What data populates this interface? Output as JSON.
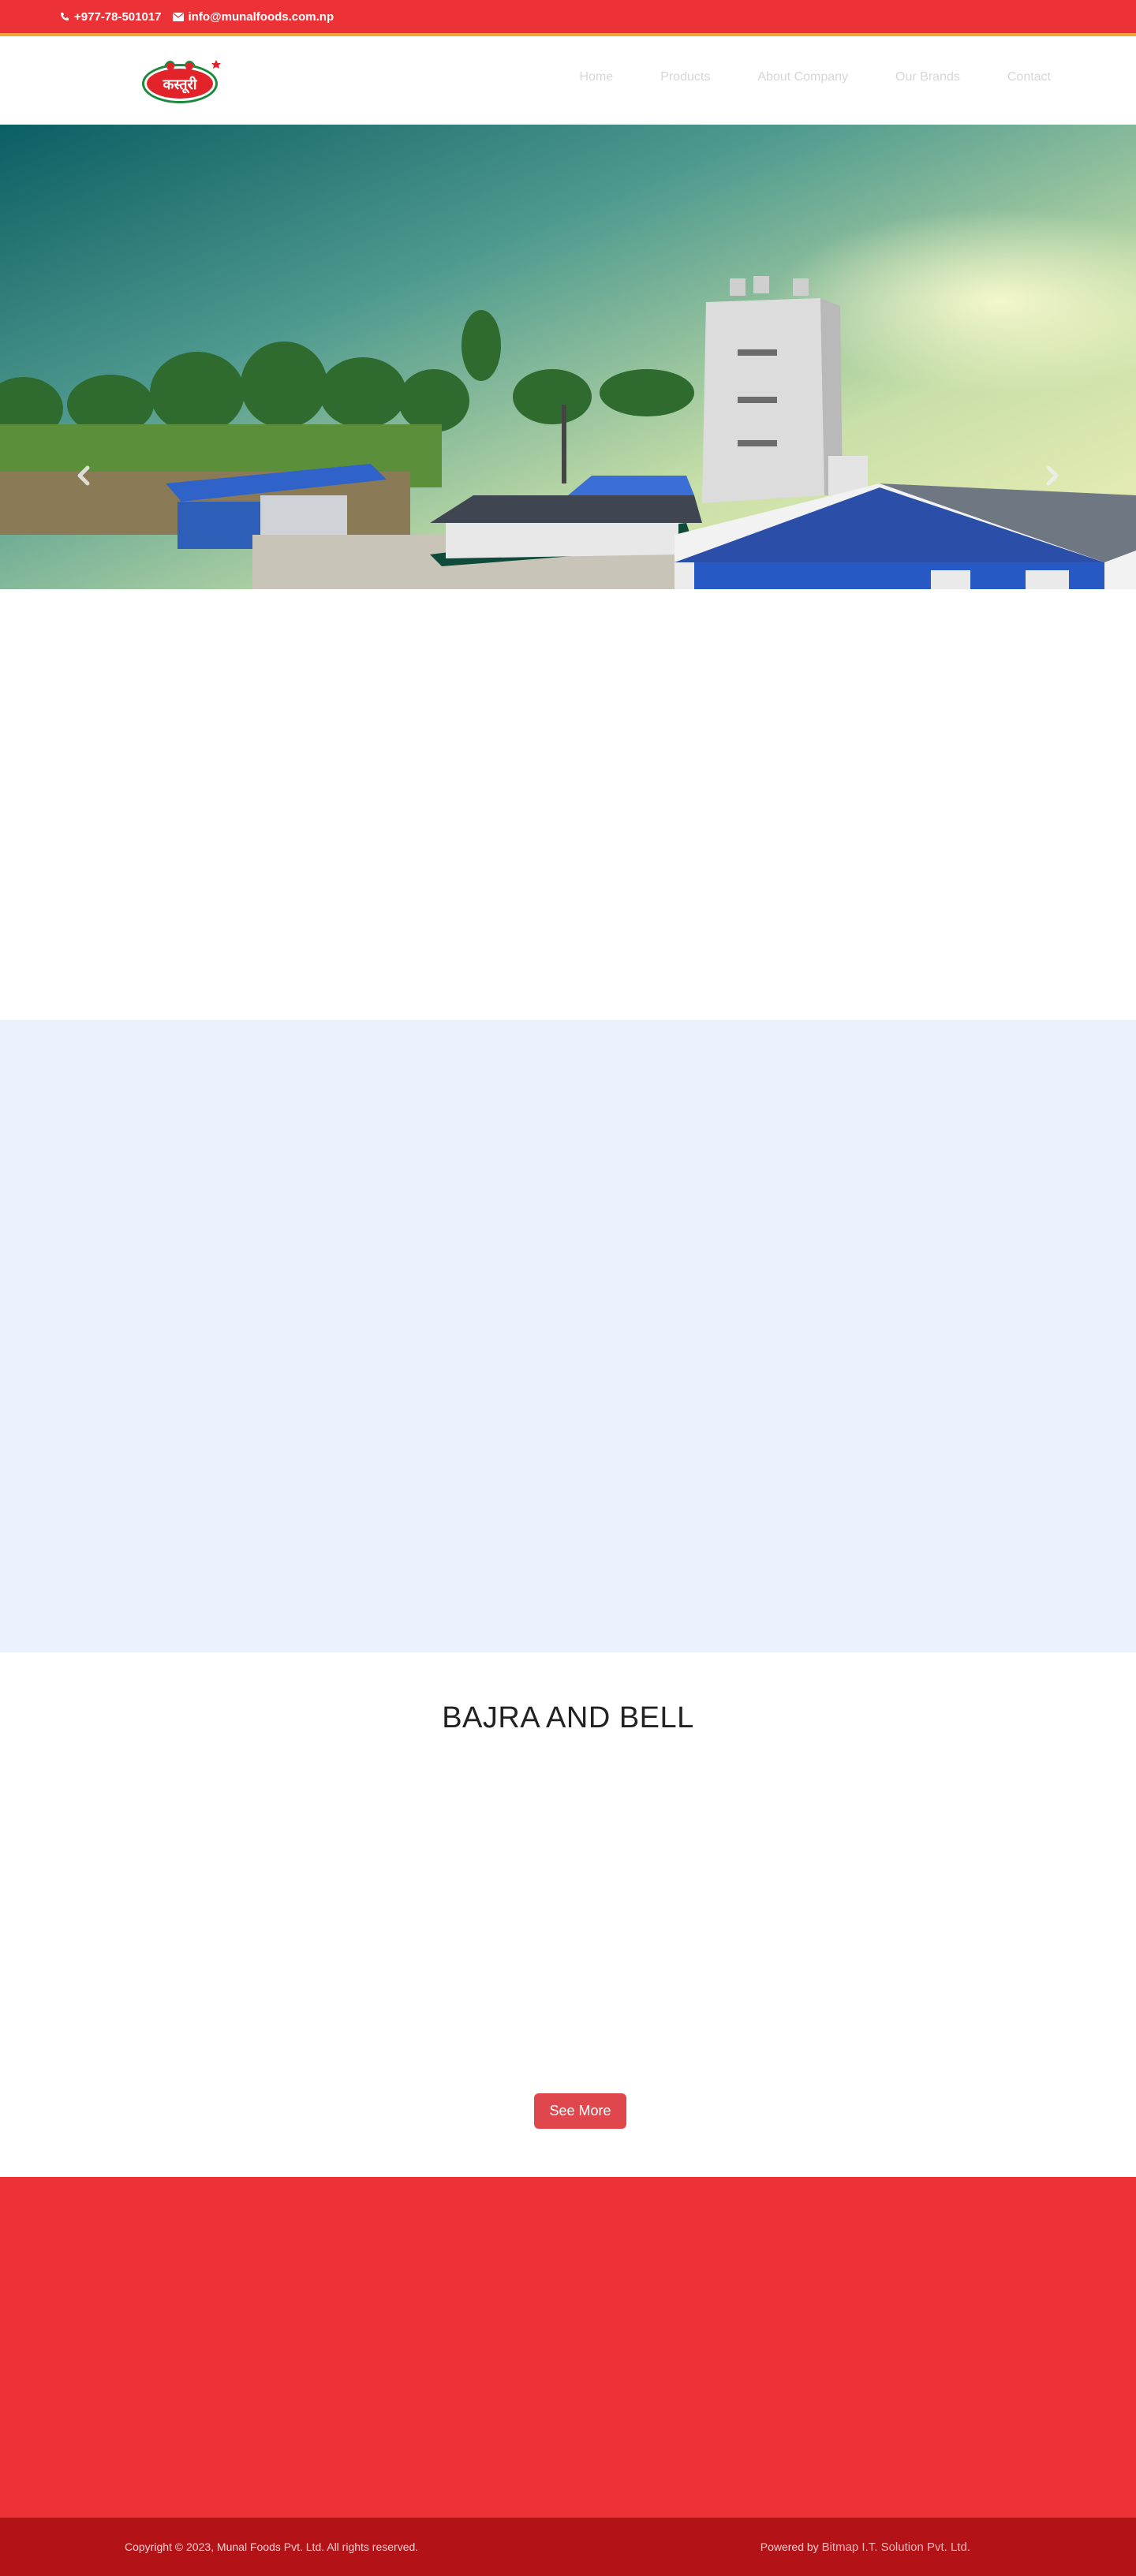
{
  "topbar": {
    "phone": "+977-78-501017",
    "email": "info@munalfoods.com.np",
    "phone_icon": "phone-icon",
    "email_icon": "envelope-icon"
  },
  "header": {
    "logo_text": "कस्तूरी",
    "nav": [
      "Home",
      "Products",
      "About Company",
      "Our Brands",
      "Contact"
    ]
  },
  "hero": {
    "prev_icon": "chevron-left-icon",
    "next_icon": "chevron-right-icon"
  },
  "bajra": {
    "title": "BAJRA AND BELL",
    "button": "See More"
  },
  "footer": {
    "copyright": "Copyright © 2023, Munal Foods Pvt. Ltd. All rights reserved.",
    "powered_prefix": "Powered by",
    "powered_link": "Bitmap I.T. Solution Pvt. Ltd."
  },
  "colors": {
    "brand_red": "#ec3237",
    "footer_red": "#b31217",
    "accent_orange": "#f6a23b",
    "light_blue": "#ebf2fd",
    "button_red": "#e0474c"
  }
}
